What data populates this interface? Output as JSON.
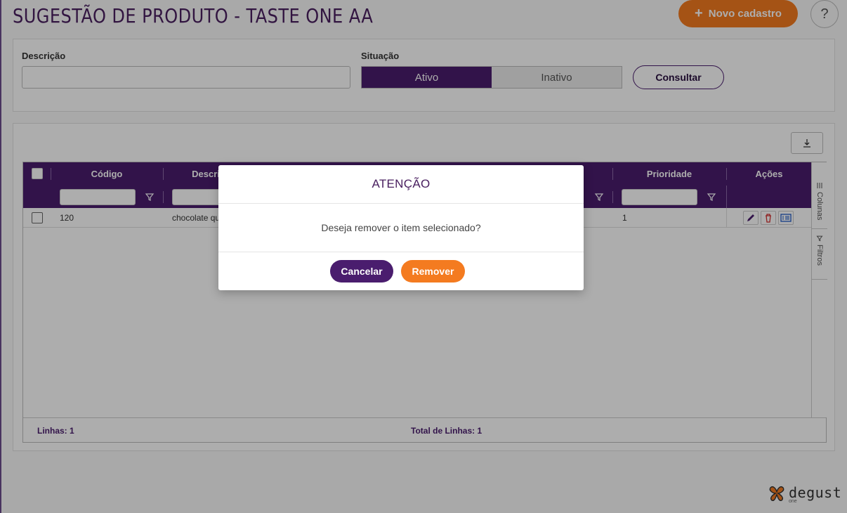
{
  "page": {
    "title": "SUGESTÃO DE PRODUTO - TASTE ONE AA",
    "new_button_label": "Novo cadastro",
    "help_label": "?"
  },
  "filters": {
    "description_label": "Descrição",
    "description_value": "",
    "status_label": "Situação",
    "status_options": [
      "Ativo",
      "Inativo"
    ],
    "status_selected": "Ativo",
    "consult_label": "Consultar"
  },
  "grid": {
    "columns": [
      "Código",
      "Descri",
      "Prioridade",
      "Ações"
    ],
    "rows": [
      {
        "codigo": "120",
        "descricao": "chocolate qu",
        "prioridade": "1"
      }
    ],
    "side_tabs": [
      "Colunas",
      "Filtros"
    ],
    "footer_lines_label": "Linhas: 1",
    "footer_total_label": "Total de Linhas: 1"
  },
  "modal": {
    "title": "ATENÇÃO",
    "message": "Deseja remover o item selecionado?",
    "cancel_label": "Cancelar",
    "remove_label": "Remover"
  },
  "brand": {
    "name": "degust",
    "sub": "one"
  },
  "colors": {
    "primary": "#4a1d6e",
    "accent": "#f47b20"
  },
  "icons": [
    "plus-icon",
    "help-icon",
    "download-icon",
    "filter-icon",
    "edit-icon",
    "trash-icon",
    "details-icon",
    "columns-icon"
  ]
}
